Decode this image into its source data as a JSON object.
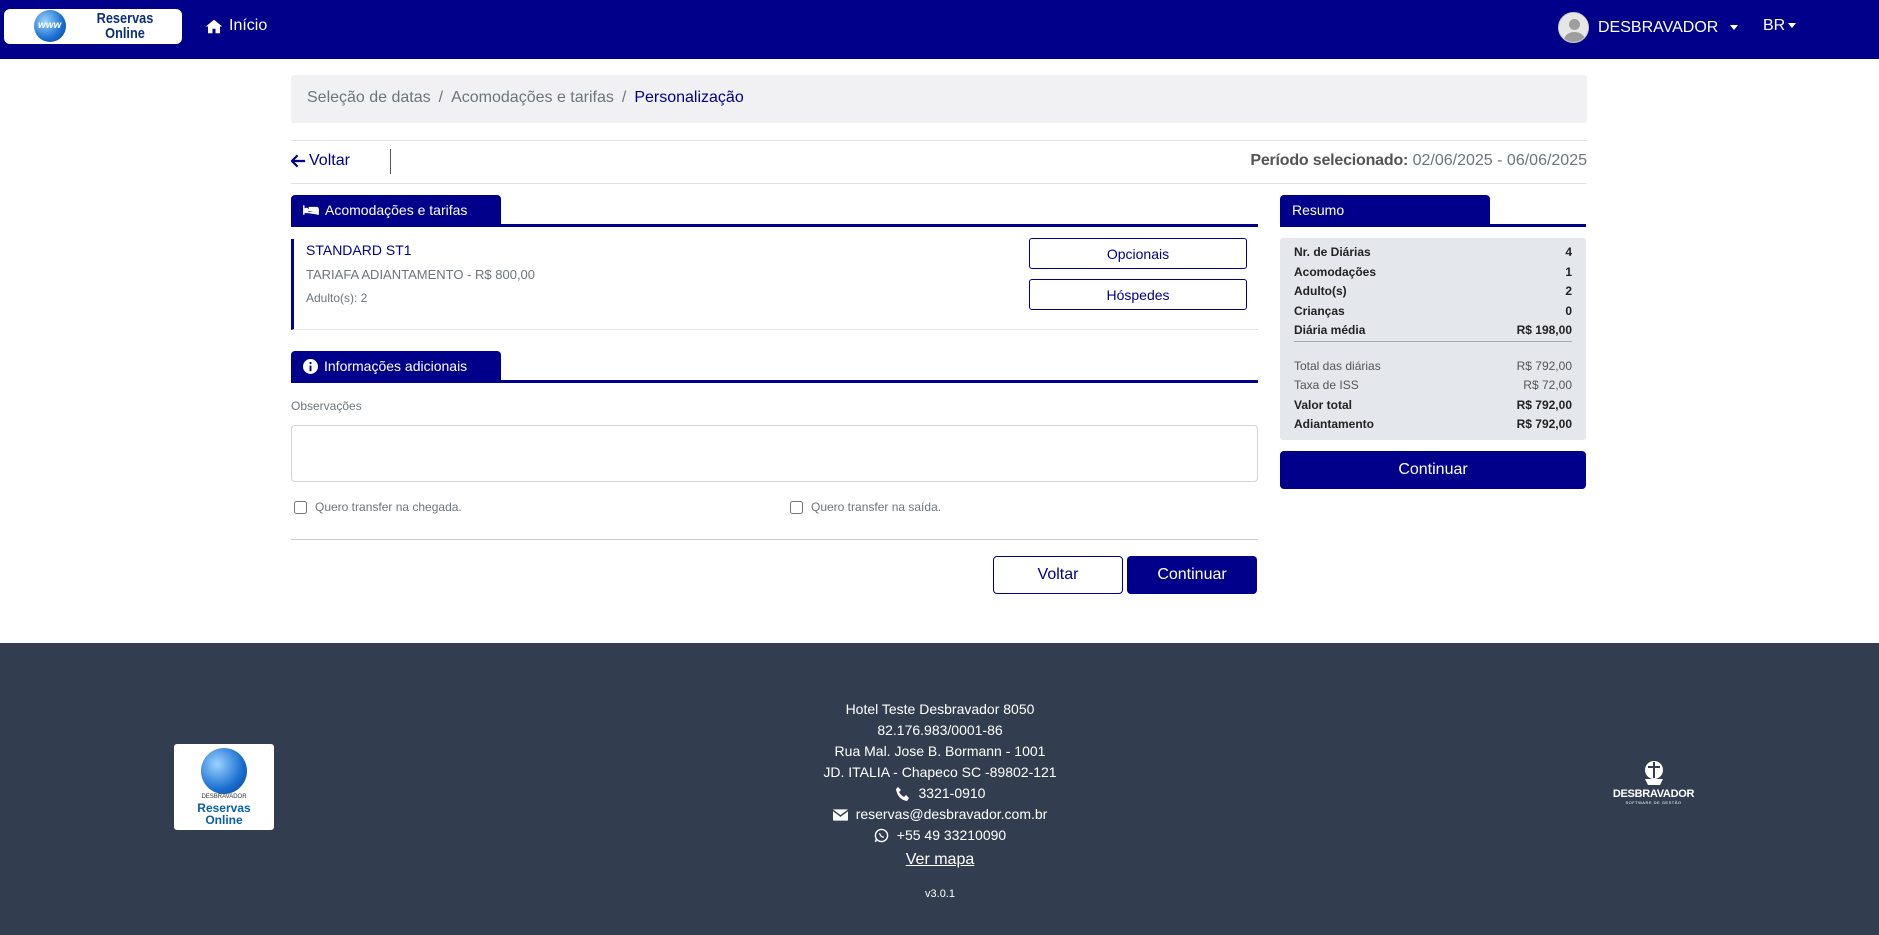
{
  "nav": {
    "logo_text_line1": "Reservas",
    "logo_text_line2": "Online",
    "logo_globe_text": "www",
    "home_label": "Início",
    "user_label": "DESBRAVADOR",
    "lang_label": "BR"
  },
  "breadcrumb": {
    "items": [
      "Seleção de datas",
      "Acomodações e tarifas",
      "Personalização"
    ],
    "separator": "/"
  },
  "topbar": {
    "back_label": "Voltar",
    "period_label": "Período selecionado:",
    "period_value": "02/06/2025 - 06/06/2025"
  },
  "accommodations": {
    "tab_label": "Acomodações e tarifas",
    "room_name": "STANDARD ST1",
    "tariff": "TARIAFA ADIANTAMENTO - R$ 800,00",
    "adults": "Adulto(s): 2",
    "optionals_button": "Opcionais",
    "guests_button": "Hóspedes"
  },
  "additional": {
    "tab_label": "Informações adicionais",
    "obs_label": "Observações",
    "obs_value": "",
    "transfer_arrival_label": "Quero transfer na chegada.",
    "transfer_departure_label": "Quero transfer na saída.",
    "transfer_arrival_checked": false,
    "transfer_departure_checked": false
  },
  "actions": {
    "back_label": "Voltar",
    "continue_label": "Continuar"
  },
  "summary": {
    "tab_label": "Resumo",
    "rows_top": [
      {
        "label": "Nr. de Diárias",
        "value": "4"
      },
      {
        "label": "Acomodações",
        "value": "1"
      },
      {
        "label": "Adulto(s)",
        "value": "2"
      },
      {
        "label": "Crianças",
        "value": "0"
      },
      {
        "label": "Diária média",
        "value": "R$ 198,00"
      }
    ],
    "rows_bottom": [
      {
        "label": "Total das diárias",
        "value": "R$ 792,00"
      },
      {
        "label": "Taxa de ISS",
        "value": "R$ 72,00"
      },
      {
        "label": "Valor total",
        "value": "R$ 792,00"
      },
      {
        "label": "Adiantamento",
        "value": "R$ 792,00"
      }
    ],
    "continue_label": "Continuar"
  },
  "footer": {
    "hotel_name": "Hotel Teste Desbravador 8050",
    "cnpj": "82.176.983/0001-86",
    "address1": "Rua Mal. Jose B. Bormann - 1001",
    "address2": "JD. ITALIA - Chapeco SC -89802-121",
    "phone": "3321-0910",
    "email": "reservas@desbravador.com.br",
    "whatsapp": "+55 49 33210090",
    "map_link": "Ver mapa",
    "version": "v3.0.1",
    "logo_small_text": "DESBRAVADOR",
    "logo_line1": "Reservas",
    "logo_line2": "Online",
    "brand_name": "DESBRAVADOR",
    "brand_tagline": "SOFTWARE DE GESTÃO"
  },
  "colors": {
    "primary": "#00008b",
    "footer_bg": "#323e4f",
    "summary_bg": "#e4e7eb",
    "breadcrumb_bg": "#f1f1f3"
  }
}
